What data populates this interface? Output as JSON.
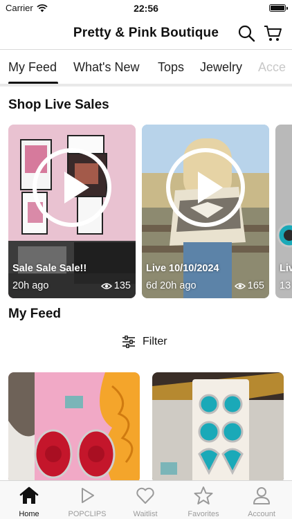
{
  "status_bar": {
    "carrier": "Carrier",
    "time": "22:56"
  },
  "header": {
    "title": "Pretty & Pink Boutique"
  },
  "tabs": [
    {
      "label": "My Feed"
    },
    {
      "label": "What's New"
    },
    {
      "label": "Tops"
    },
    {
      "label": "Jewelry"
    },
    {
      "label": "Acce"
    }
  ],
  "live_sales": {
    "title": "Shop Live Sales",
    "items": [
      {
        "caption": "Sale Sale Sale!!",
        "ago": "20h ago",
        "views": "135"
      },
      {
        "caption": "Live 10/10/2024",
        "ago": "6d 20h ago",
        "views": "165"
      },
      {
        "caption": "Liv",
        "ago": "13",
        "views": ""
      }
    ]
  },
  "my_feed": {
    "title": "My Feed",
    "filter_label": "Filter"
  },
  "tab_bar": [
    {
      "label": "Home",
      "icon": "home-icon"
    },
    {
      "label": "POPCLIPS",
      "icon": "play-icon"
    },
    {
      "label": "Waitlist",
      "icon": "heart-icon"
    },
    {
      "label": "Favorites",
      "icon": "star-icon"
    },
    {
      "label": "Account",
      "icon": "person-icon"
    }
  ],
  "colors": {
    "accent": "#111111",
    "inactive": "#9a9a9a",
    "turquoise": "#1aa9b8",
    "pink": "#f1a9c6"
  }
}
